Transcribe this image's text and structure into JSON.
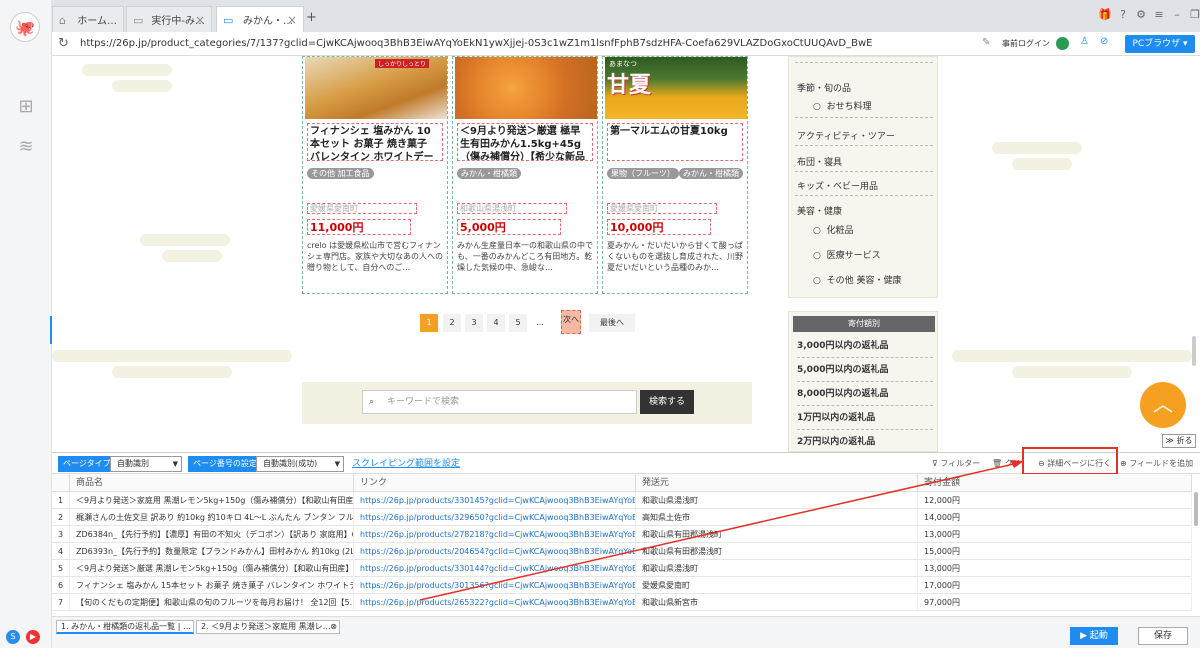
{
  "tabs": [
    {
      "label": "ホーム…"
    },
    {
      "label": "実行中-み…"
    },
    {
      "label": "みかん・…"
    }
  ],
  "address": {
    "url": "https://26p.jp/product_categories/7/137?gclid=CjwKCAjwooq3BhB3EiwAYqYoEkN1ywXjjej-0S3c1wZ1m1lsnfFphB7sdzHFA-Coefa629VLAZDoGxoCtUUQAvD_BwE",
    "login_label": "事前ログイン",
    "pc_browser": "PCブラウザ"
  },
  "cards": [
    {
      "banner": "しっかりしっとり",
      "title": "フィナンシェ 塩みかん 10本セット お菓子 焼き菓子 バレンタイン ホワイトデー 河…",
      "tags": [
        "その他 加工食品"
      ],
      "pref": "愛媛県愛南町",
      "price": "11,000円",
      "desc": "crelo は愛媛県松山市で営むフィナンシェ専門店。家族や大切なあの人への贈り物として、自分へのご…"
    },
    {
      "banner": "",
      "title": "＜9月より発送＞厳選 極早生有田みかん1.5kg+45g（傷み補償分）【希少な新品種Y…",
      "tags": [
        "みかん・柑橘類"
      ],
      "pref": "和歌山県湯浅町",
      "price": "5,000円",
      "desc": "みかん生産量日本一の和歌山県の中でも、一番のみかんどころ有田地方。乾燥した気候の中、急峻な…"
    },
    {
      "banner": "あまなつ",
      "banner_big": "甘夏",
      "title": "第一マルエムの甘夏10kg",
      "tags": [
        "果物（フルーツ）",
        "みかん・柑橘類"
      ],
      "pref": "愛媛県愛南町",
      "price": "10,000円",
      "desc": "夏みかん・だいだいから甘くて酸っぱくないものを選抜し育成された、川野夏だいだいという品種のみか…"
    }
  ],
  "pagination": {
    "pages": [
      "1",
      "2",
      "3",
      "4",
      "5",
      "..."
    ],
    "next": "次へ",
    "last": "最後へ"
  },
  "rightnav": {
    "items": [
      {
        "label": "季節・旬の品",
        "sub": false
      },
      {
        "label": "おせち料理",
        "sub": true
      },
      {
        "label": "アクティビティ・ツアー",
        "sub": false
      },
      {
        "label": "布団・寝具",
        "sub": false
      },
      {
        "label": "キッズ・ベビー用品",
        "sub": false
      },
      {
        "label": "美容・健康",
        "sub": false
      },
      {
        "label": "化粧品",
        "sub": true
      },
      {
        "label": "医療サービス",
        "sub": true
      },
      {
        "label": "その他 美容・健康",
        "sub": true
      }
    ]
  },
  "donation": {
    "header": "寄付額別",
    "items": [
      "3,000円以内の返礼品",
      "5,000円以内の返礼品",
      "8,000円以内の返礼品",
      "1万円以内の返礼品",
      "2万円以内の返礼品"
    ]
  },
  "search": {
    "placeholder": "キーワードで検索",
    "button": "検索する"
  },
  "fold_label": "折る",
  "toolbar": {
    "page_type_label": "ページタイプ",
    "page_type_value": "自動識別",
    "page_no_label": "ページ番号の設定",
    "page_no_value": "自動識別(成功)",
    "scrape_link": "スクレイピング範囲を設定",
    "filter": "フィルター",
    "clear": "クリ",
    "detail": "詳細ページに行く",
    "add_field": "フィールドを追加"
  },
  "table": {
    "columns": [
      "商品名",
      "リンク",
      "発送元",
      "寄付金額"
    ],
    "rows": [
      {
        "no": "1",
        "name": "＜9月より発送＞家庭用 黒潮レモン5kg+150g（傷み補償分）【和歌山有田産】…",
        "link": "https://26p.jp/products/330145?gclid=CjwKCAjwooq3BhB3EiwAYqYoEkN1ywXjj…",
        "origin": "和歌山県湯浅町",
        "amount": "12,000円"
      },
      {
        "no": "2",
        "name": "梶瀬さんの土佐文旦 訳あり 約10kg 約10キロ 4L～L ぶんたん ブンタン フルー…",
        "link": "https://26p.jp/products/329650?gclid=CjwKCAjwooq3BhB3EiwAYqYoEkN1ywXjj…",
        "origin": "高知県土佐市",
        "amount": "14,000円"
      },
      {
        "no": "3",
        "name": "ZD6384n_【先行予約】【濃厚】有田の不知火（デコポン）【訳あり 家庭用】6.…",
        "link": "https://26p.jp/products/278218?gclid=CjwKCAjwooq3BhB3EiwAYqYoEkN1ywXjj…",
        "origin": "和歌山県有田郡湯浅町",
        "amount": "13,000円"
      },
      {
        "no": "4",
        "name": "ZD6393n_【先行予約】数量限定【ブランドみかん】田村みかん 約10kg (2Lサ…",
        "link": "https://26p.jp/products/204654?gclid=CjwKCAjwooq3BhB3EiwAYqYoEkN1ywXjj…",
        "origin": "和歌山県有田郡湯浅町",
        "amount": "15,000円"
      },
      {
        "no": "5",
        "name": "＜9月より発送＞厳選 黒潮レモン5kg+150g（傷み補償分）【和歌山有田産】…",
        "link": "https://26p.jp/products/330144?gclid=CjwKCAjwooq3BhB3EiwAYqYoEkN1ywXjj…",
        "origin": "和歌山県湯浅町",
        "amount": "13,000円"
      },
      {
        "no": "6",
        "name": "フィナンシェ 塩みかん 15本セット お菓子 焼き菓子 バレンタイン ホワイトデ…",
        "link": "https://26p.jp/products/301356?gclid=CjwKCAjwooq3BhB3EiwAYqYoEkN1ywXjj…",
        "origin": "愛媛県愛南町",
        "amount": "17,000円"
      },
      {
        "no": "7",
        "name": "【旬のくだもの定期便】和歌山県の旬のフルーツを毎月お届け！ 全12回【5…",
        "link": "https://26p.jp/products/265322?gclid=CjwKCAjwooq3BhB3EiwAYqYoEkN1ywXjj…",
        "origin": "和歌山県新宮市",
        "amount": "97,000円"
      }
    ]
  },
  "bottom": {
    "tab1": "1. みかん・柑橘類の返礼品一覧 | …",
    "tab2": "2. ＜9月より発送＞家庭用 黒潮レ…",
    "run": "起動",
    "save": "保存"
  },
  "colors": {
    "accent": "#1e8cf0",
    "highlight": "#e53027",
    "orange": "#f5a020"
  }
}
